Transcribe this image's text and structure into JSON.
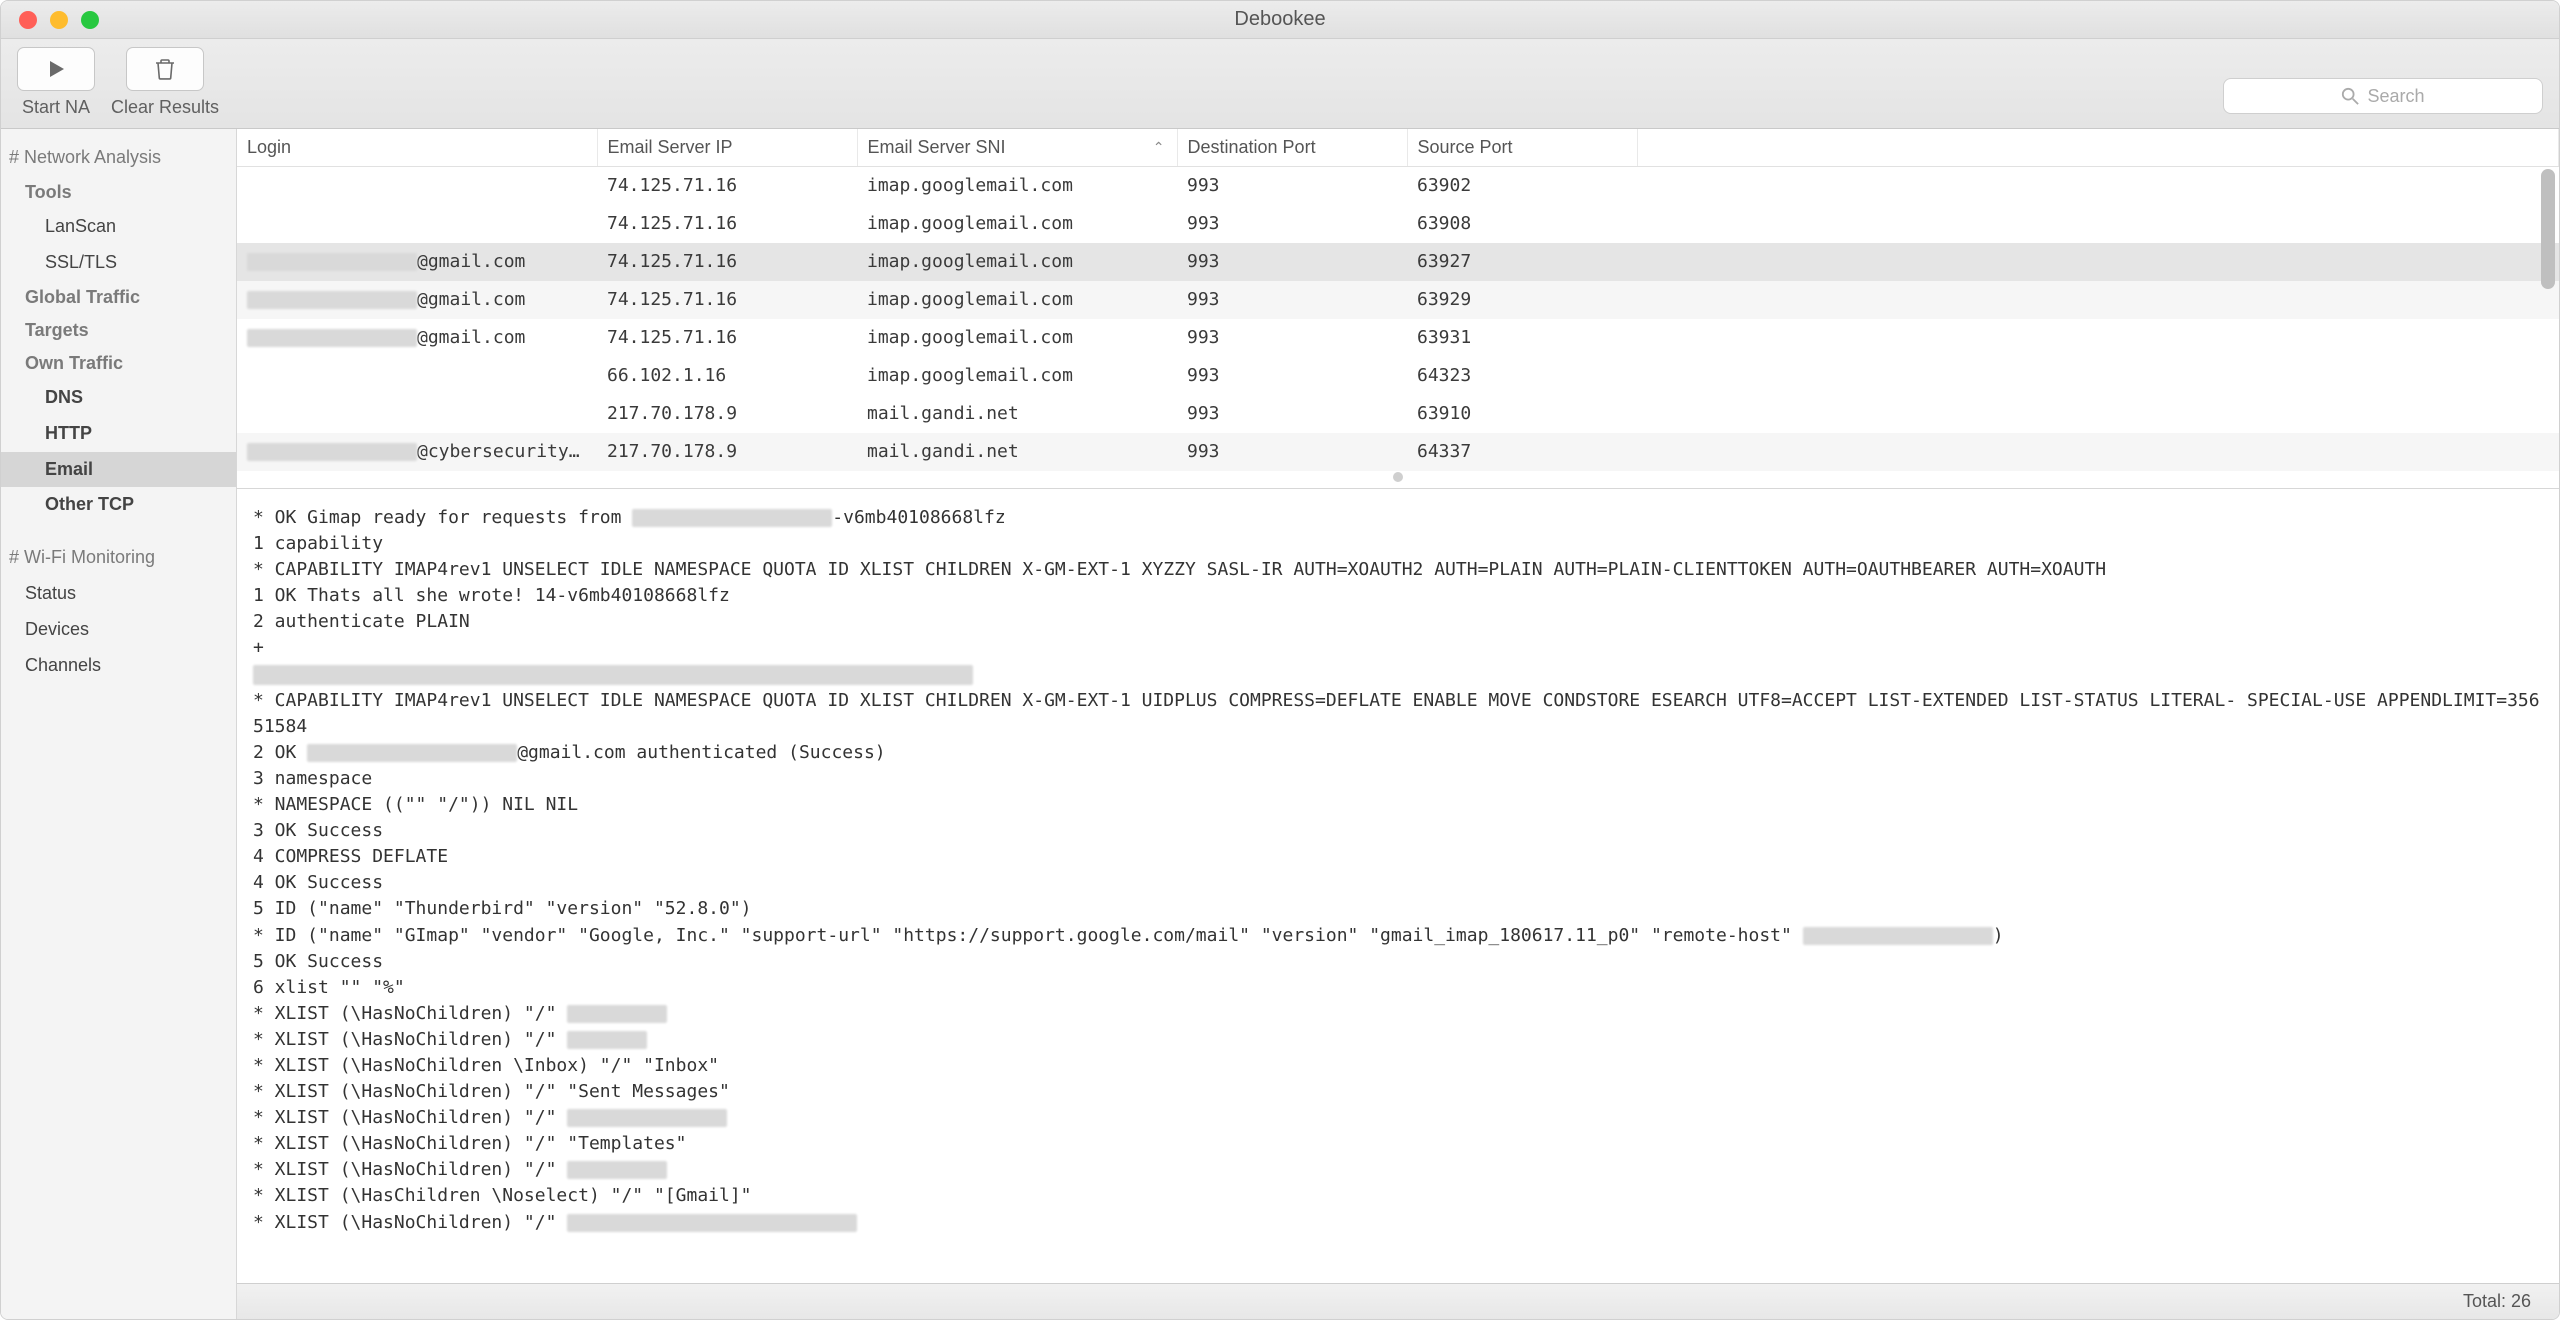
{
  "window": {
    "title": "Debookee"
  },
  "toolbar": {
    "start_label": "Start NA",
    "clear_label": "Clear Results"
  },
  "search": {
    "placeholder": "Search"
  },
  "sidebar": {
    "heads": {
      "na": "# Network Analysis",
      "wifi": "# Wi-Fi Monitoring"
    },
    "sections": {
      "tools": "Tools",
      "global": "Global Traffic",
      "targets": "Targets",
      "own": "Own Traffic"
    },
    "items": {
      "lanscan": "LanScan",
      "ssltls": "SSL/TLS",
      "dns": "DNS",
      "http": "HTTP",
      "email": "Email",
      "othertcp": "Other TCP",
      "status": "Status",
      "devices": "Devices",
      "channels": "Channels"
    }
  },
  "table": {
    "columns": [
      "Login",
      "Email Server IP",
      "Email Server SNI",
      "Destination Port",
      "Source Port"
    ],
    "rows": [
      {
        "login": "",
        "ip": "74.125.71.16",
        "sni": "imap.googlemail.com",
        "dport": "993",
        "sport": "63902",
        "sel": false,
        "blur": false
      },
      {
        "login": "",
        "ip": "74.125.71.16",
        "sni": "imap.googlemail.com",
        "dport": "993",
        "sport": "63908",
        "sel": false,
        "blur": false
      },
      {
        "login": "@gmail.com",
        "ip": "74.125.71.16",
        "sni": "imap.googlemail.com",
        "dport": "993",
        "sport": "63927",
        "sel": true,
        "blur": true
      },
      {
        "login": "@gmail.com",
        "ip": "74.125.71.16",
        "sni": "imap.googlemail.com",
        "dport": "993",
        "sport": "63929",
        "sel": false,
        "blur": true,
        "zebra": true
      },
      {
        "login": "@gmail.com",
        "ip": "74.125.71.16",
        "sni": "imap.googlemail.com",
        "dport": "993",
        "sport": "63931",
        "sel": false,
        "blur": true
      },
      {
        "login": "",
        "ip": "66.102.1.16",
        "sni": "imap.googlemail.com",
        "dport": "993",
        "sport": "64323",
        "sel": false,
        "blur": false
      },
      {
        "login": "",
        "ip": "217.70.178.9",
        "sni": "mail.gandi.net",
        "dport": "993",
        "sport": "63910",
        "sel": false,
        "blur": false
      },
      {
        "login": "@cybersecurityallia…",
        "ip": "217.70.178.9",
        "sni": "mail.gandi.net",
        "dport": "993",
        "sport": "64337",
        "sel": false,
        "blur": true,
        "zebra": true
      }
    ]
  },
  "detail": {
    "l1a": "* OK Gimap ready for requests from ",
    "l1b": "-v6mb40108668lfz",
    "l2": "1 capability",
    "l3": "* CAPABILITY IMAP4rev1 UNSELECT IDLE NAMESPACE QUOTA ID XLIST CHILDREN X-GM-EXT-1 XYZZY SASL-IR AUTH=XOAUTH2 AUTH=PLAIN AUTH=PLAIN-CLIENTTOKEN AUTH=OAUTHBEARER AUTH=XOAUTH",
    "l4": "1 OK Thats all she wrote! 14-v6mb40108668lfz",
    "l5": "2 authenticate PLAIN",
    "l6": "+",
    "l8": "* CAPABILITY IMAP4rev1 UNSELECT IDLE NAMESPACE QUOTA ID XLIST CHILDREN X-GM-EXT-1 UIDPLUS COMPRESS=DEFLATE ENABLE MOVE CONDSTORE ESEARCH UTF8=ACCEPT LIST-EXTENDED LIST-STATUS LITERAL- SPECIAL-USE APPENDLIMIT=35651584",
    "l9a": "2 OK ",
    "l9b": "@gmail.com authenticated (Success)",
    "l10": "3 namespace",
    "l11": "* NAMESPACE ((\"\" \"/\")) NIL NIL",
    "l12": "3 OK Success",
    "l13": "4 COMPRESS DEFLATE",
    "l14": "4 OK Success",
    "l15": "5 ID (\"name\" \"Thunderbird\" \"version\" \"52.8.0\")",
    "l16a": "* ID (\"name\" \"GImap\" \"vendor\" \"Google, Inc.\" \"support-url\" \"https://support.google.com/mail\" \"version\" \"gmail_imap_180617.11_p0\" \"remote-host\" ",
    "l16b": ")",
    "l17": "5 OK Success",
    "l18": "6 xlist \"\" \"%\"",
    "l19": "* XLIST (\\HasNoChildren) \"/\" ",
    "l20": "* XLIST (\\HasNoChildren) \"/\" ",
    "l21": "* XLIST (\\HasNoChildren \\Inbox) \"/\" \"Inbox\"",
    "l22": "* XLIST (\\HasNoChildren) \"/\" \"Sent Messages\"",
    "l23": "* XLIST (\\HasNoChildren) \"/\" ",
    "l24": "* XLIST (\\HasNoChildren) \"/\" \"Templates\"",
    "l25": "* XLIST (\\HasNoChildren) \"/\" ",
    "l26": "* XLIST (\\HasChildren \\Noselect) \"/\" \"[Gmail]\"",
    "l27": "* XLIST (\\HasNoChildren) \"/\" "
  },
  "status": {
    "total_label": "Total: 26"
  }
}
